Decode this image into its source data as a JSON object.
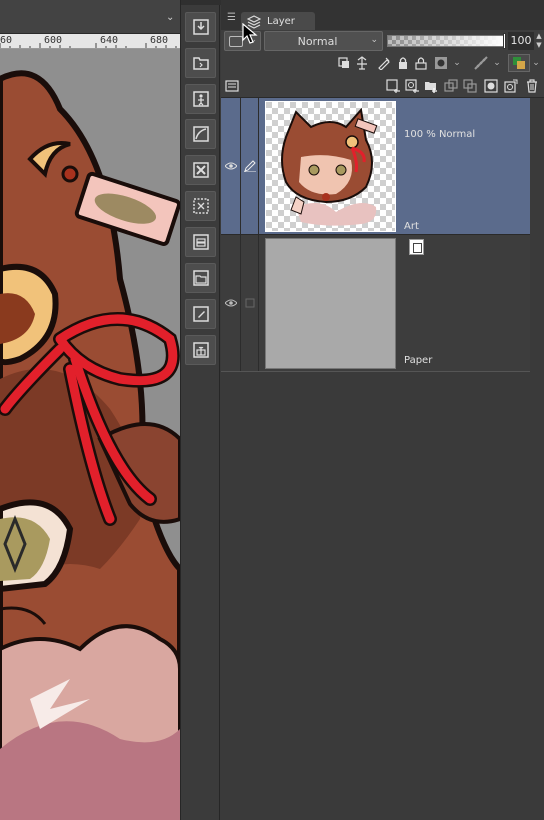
{
  "ruler": {
    "labels": [
      "60",
      "600",
      "640",
      "680"
    ]
  },
  "panel": {
    "tab_label": "Layer",
    "blend_mode": "Normal",
    "opacity_value": "100",
    "opacity_fraction": 1.0
  },
  "layers": [
    {
      "name": "Art",
      "info": "100 % Normal",
      "selected": true,
      "visible": true
    },
    {
      "name": "Paper",
      "info": "",
      "selected": false,
      "visible": true
    }
  ],
  "colors": {
    "selected_layer_bg": "#5b6b8c",
    "panel_bg": "#3a3a3a",
    "canvas_bg": "#8f8f8f"
  },
  "icons": {
    "command_bar": [
      "import-icon",
      "folder-icon",
      "layer-property-icon",
      "brush-curve-icon",
      "delete-icon",
      "transform-icon",
      "merge-icon",
      "folder-layer-icon",
      "edit-layer-icon",
      "gift-icon"
    ],
    "toolbar_row1": [
      "clip-icon",
      "reference-icon",
      "draft-icon",
      "lock-icon",
      "lock-transparent-icon",
      "mask-icon",
      "ruler-icon",
      "color-icon"
    ],
    "toolbar_row2": [
      "new-raster-icon",
      "new-vector-icon",
      "new-folder-icon",
      "copy-layer-icon",
      "merge-down-icon",
      "mask-add-icon",
      "delete-layer-icon"
    ]
  }
}
